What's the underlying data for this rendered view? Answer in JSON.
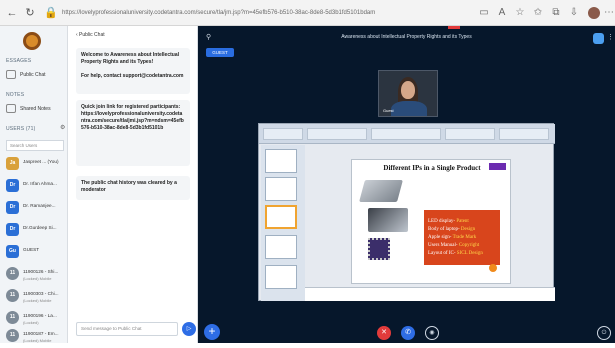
{
  "browser": {
    "url": "https://lovelyprofessionaluniversity.codetantra.com/secure/tla/jm.jsp?m=45efb576-b510-38ac-8de8-5d3b1fd5101bdam",
    "icons": [
      "back-icon",
      "refresh-icon",
      "lock-icon",
      "reader-icon",
      "zoom-icon",
      "favorite-icon",
      "collections-icon",
      "download-icon",
      "profile-icon",
      "more-icon"
    ]
  },
  "sidebar": {
    "messages_heading": "ESSAGES",
    "public_chat": "Public Chat",
    "notes_heading": "NOTES",
    "shared_notes": "Shared Notes",
    "users_heading": "USERS (71)",
    "search_placeholder": "Search Users",
    "users": [
      {
        "initials": "Ja",
        "name": "Jaspreet ... (You)",
        "sub": "",
        "color": "#d9a13b"
      },
      {
        "initials": "Dr",
        "name": "Dr. Irfan Ahma...",
        "sub": "",
        "color": "#2b6fd6"
      },
      {
        "initials": "Dr",
        "name": "Dr. Ramanjee...",
        "sub": "",
        "color": "#2b6fd6"
      },
      {
        "initials": "Dr",
        "name": "Dr.Gurdeep Si...",
        "sub": "",
        "color": "#2b6fd6"
      },
      {
        "initials": "Gu",
        "name": "GUEST",
        "sub": "",
        "color": "#2b6fd6"
      },
      {
        "initials": "11",
        "name": "11900126 - Shi...",
        "sub": "(Locked) Mobile",
        "color": "#7d8a97"
      },
      {
        "initials": "11",
        "name": "11900303 - Chi...",
        "sub": "(Locked) Mobile",
        "color": "#7d8a97"
      },
      {
        "initials": "11",
        "name": "11900196 - La...",
        "sub": "(Locked)",
        "color": "#7d8a97"
      },
      {
        "initials": "11",
        "name": "11900187 - Em...",
        "sub": "(Locked) Mobile",
        "color": "#7d8a97"
      }
    ]
  },
  "chat": {
    "back_label": "‹ Public Chat",
    "welcome_line1": "Welcome to Awareness about Intellectual Property Rights and its Types!",
    "welcome_line2": "For help, contact support@codetantra.com",
    "quickjoin_title": "Quick join link for registered participants:",
    "quickjoin_link": "https://lovelyprofessionaluniversity.codetantra.com/secure/tla/jmi.jsp?m=ndsm=45efb576-b510-38ac-8de8-5d3b1fd5101b",
    "cleared": "The public chat history was cleared by a moderator",
    "input_placeholder": "Send message to Public Chat"
  },
  "main": {
    "meeting_title": "Awareness about Intellectual Property Rights and its Types",
    "guest_badge": "GUEST",
    "webcam_label": "Guest",
    "slide": {
      "title": "Different IPs in a Single Product",
      "lines": [
        {
          "label": "LED display- ",
          "value": "Patent"
        },
        {
          "label": "Body of laptop- ",
          "value": "Design"
        },
        {
          "label": "Apple sign- ",
          "value": "Trade Mark"
        },
        {
          "label": "Users Manual- ",
          "value": "Copyright"
        },
        {
          "label": "Layout of IC- ",
          "value": "SICL Design"
        }
      ]
    }
  },
  "colors": {
    "accent": "#2e6de5",
    "main_bg": "#06172b",
    "mic_red": "#e23b3b"
  }
}
